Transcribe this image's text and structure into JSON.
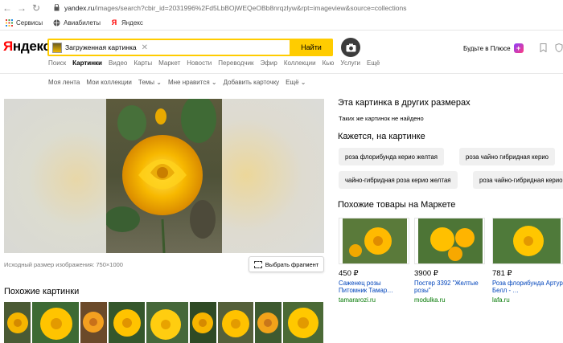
{
  "browser": {
    "url_host": "yandex.ru",
    "url_rest": "/images/search?cbir_id=2031996%2Fd5LbBOjWEQeOBb8nrqzlyw&rpt=imageview&source=collections",
    "bookmarks": [
      "Сервисы",
      "Авиабилеты",
      "Яндекс"
    ]
  },
  "header": {
    "logo_red": "Я",
    "logo_rest": "ндекс",
    "search_chip": "Загруженная картинка",
    "search_button": "Найти",
    "plus_text": "Будьте в Плюсе",
    "plus_icon": "+"
  },
  "services": [
    "Поиск",
    "Картинки",
    "Видео",
    "Карты",
    "Маркет",
    "Новости",
    "Переводчик",
    "Эфир",
    "Коллекции",
    "Кью",
    "Услуги",
    "Ещё"
  ],
  "subnav": [
    "Моя лента",
    "Мои коллекции",
    "Темы ⌄",
    "Мне нравится ⌄",
    "Добавить карточку",
    "Ещё ⌄"
  ],
  "main": {
    "original_size": "Исходный размер изображения: 750×1000",
    "fragment_button": "Выбрать фрагмент",
    "similar_title": "Похожие картинки"
  },
  "right": {
    "sizes_title": "Эта картинка в других размерах",
    "sizes_empty": "Таких же картинок не найдено",
    "seems_title": "Кажется, на картинке",
    "tags": [
      "роза флорибунда керио желтая",
      "роза чайно гибридная керио",
      "чайно-гибридная роза керио желтая",
      "роза чайно-гибридная керио"
    ],
    "market_title": "Похожие товары на Маркете",
    "products": [
      {
        "price": "450 ₽",
        "name": "Саженец розы Питомник Тамар…",
        "shop": "tamararozi.ru"
      },
      {
        "price": "3900 ₽",
        "name": "Постер 3392 \"Желтые розы\"",
        "shop": "modulka.ru"
      },
      {
        "price": "781 ₽",
        "name": "Роза флорибунда Артур Белл - …",
        "shop": "lafa.ru"
      }
    ]
  },
  "colors": {
    "accent": "#ffcc00",
    "link": "#0044bb",
    "shop": "#007700"
  }
}
